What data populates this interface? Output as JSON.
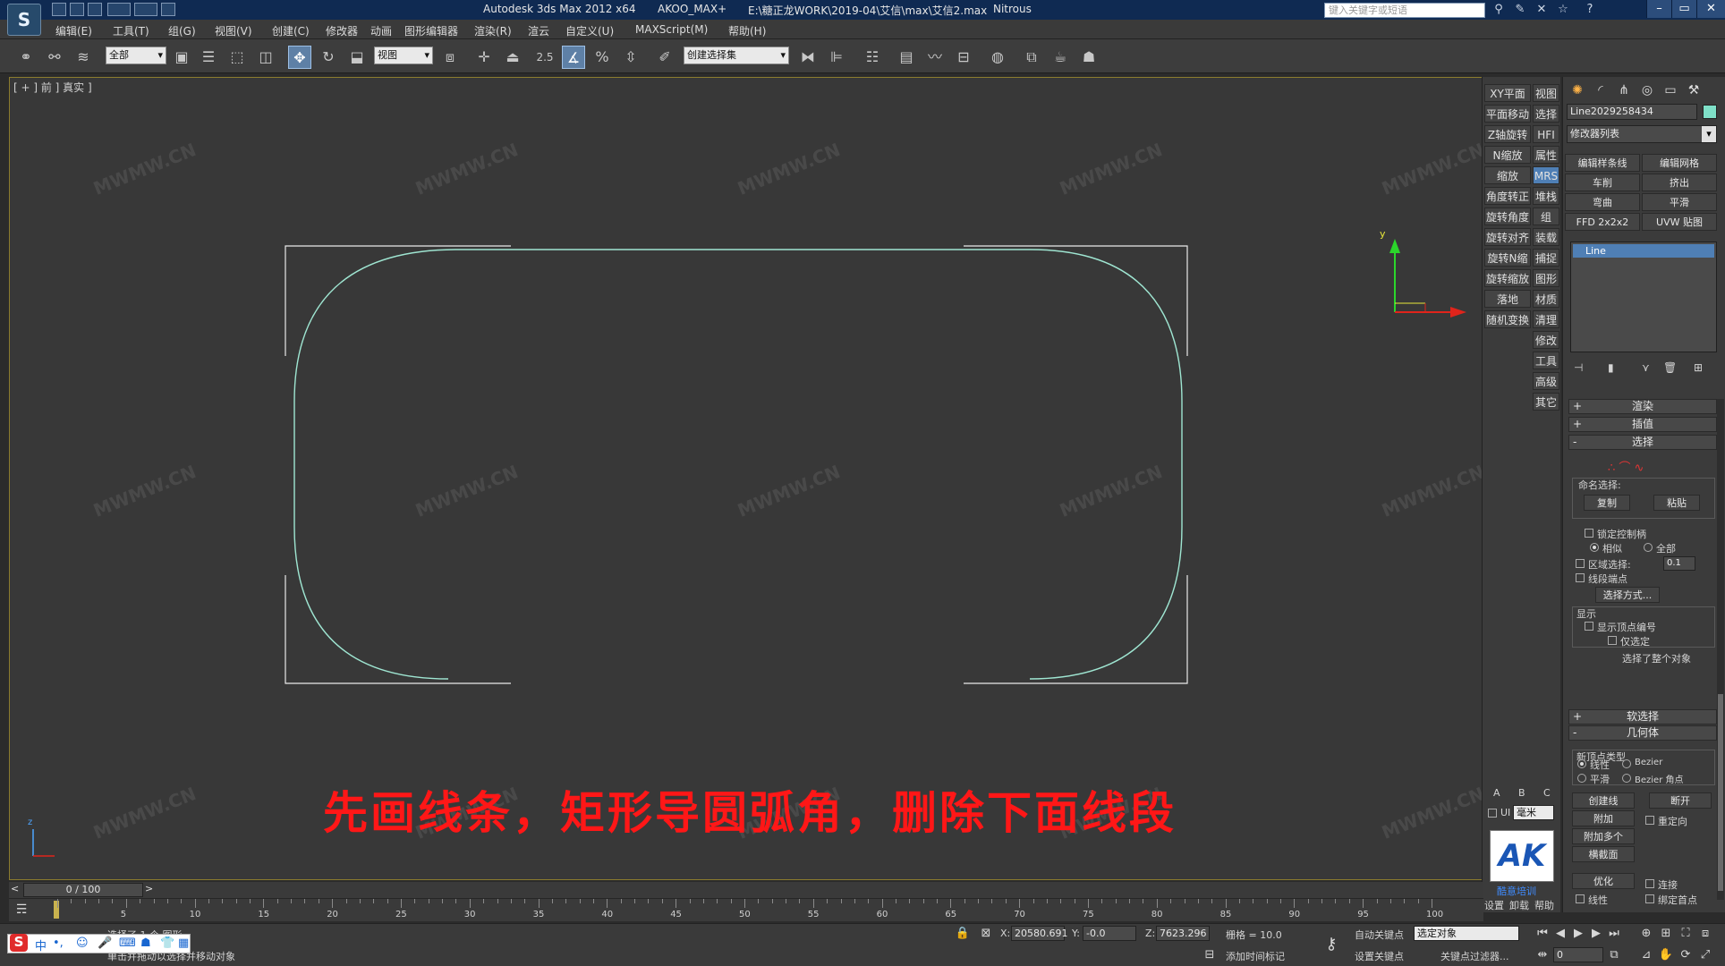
{
  "titlebar": {
    "app_title": "Autodesk 3ds Max  2012 x64",
    "plugin": "AKOO_MAX+",
    "file_path": "E:\\糖正龙WORK\\2019-04\\艾信\\max\\艾信2.max",
    "renderer": "Nitrous",
    "search_placeholder": "键入关键字或短语",
    "help_label": "?",
    "minimize": "–",
    "restore": "▭",
    "close": "✕"
  },
  "menu": [
    "编辑(E)",
    "工具(T)",
    "组(G)",
    "视图(V)",
    "创建(C)",
    "修改器",
    "动画",
    "图形编辑器",
    "渲染(R)",
    "渲云",
    "自定义(U)",
    "MAXScript(M)",
    "帮助(H)"
  ],
  "toolbar": {
    "selection_filter": "全部",
    "reference_coord": "视图",
    "snap_value": "2.5",
    "named_selection": "创建选择集"
  },
  "viewport": {
    "label": "[ + ] 前 ] 真实 ]",
    "axis_y": "y",
    "axis_z": "z",
    "watermark": "MWMW.CN",
    "caption": "先画线条，矩形导圆弧角，删除下面线段"
  },
  "command_strip": [
    [
      "XY平面",
      "视图"
    ],
    [
      "平面移动",
      "选择"
    ],
    [
      "Z轴旋转",
      "HFI"
    ],
    [
      "N缩放",
      "属性"
    ],
    [
      "缩放",
      "MRS"
    ],
    [
      "角度转正",
      "堆栈"
    ],
    [
      "旋转角度",
      "组"
    ],
    [
      "旋转对齐",
      "装载"
    ],
    [
      "旋转N缩",
      "捕捉"
    ],
    [
      "旋转缩放",
      "图形"
    ],
    [
      "落地",
      "材质"
    ],
    [
      "随机变换",
      "清理"
    ],
    [
      "",
      "修改"
    ],
    [
      "",
      "工具"
    ],
    [
      "",
      "高级"
    ],
    [
      "",
      "其它"
    ]
  ],
  "command_strip_bottom": {
    "abc": [
      "A",
      "B",
      "C"
    ],
    "units_label": "UI",
    "units_value": "毫米",
    "logo_text": "AK",
    "logo_caption": "酷意培训",
    "bottom_links": [
      "设置",
      "卸载",
      "帮助"
    ]
  },
  "panel": {
    "object_name": "Line2029258434",
    "object_color": "#7fe0c8",
    "modifier_list": "修改器列表",
    "mod_buttons": [
      "编辑样条线",
      "编辑网格",
      "车削",
      "挤出",
      "弯曲",
      "平滑",
      "FFD 2x2x2",
      "UVW 贴图"
    ],
    "stack_item": "Line",
    "rollouts": {
      "render": "渲染",
      "interp": "插值",
      "selection": "选择",
      "soft_sel": "软选择",
      "geometry": "几何体"
    },
    "named_sel": {
      "title": "命名选择:",
      "copy": "复制",
      "paste": "粘贴"
    },
    "lock_handles": "锁定控制柄",
    "alike": "相似",
    "all": "全部",
    "area_select": "区域选择:",
    "area_value": "0.1",
    "segment_end": "线段端点",
    "select_by": "选择方式...",
    "display": "显示",
    "show_vertex_num": "显示顶点编号",
    "selected_only": "仅选定",
    "selected_whole": "选择了整个对象",
    "new_vertex_type": "新顶点类型",
    "linear": "线性",
    "bezier": "Bezier",
    "smooth": "平滑",
    "bezier_corner": "Bezier 角点",
    "create_line": "创建线",
    "break": "断开",
    "attach": "附加",
    "reorient": "重定向",
    "attach_multi": "附加多个",
    "cross_section": "横截面",
    "optimize": "优化",
    "connect": "连接",
    "linear2": "线性",
    "bind_first": "绑定首点"
  },
  "timeline": {
    "frame": "0 / 100",
    "ticks": [
      "5",
      "10",
      "15",
      "20",
      "25",
      "30",
      "35",
      "40",
      "45",
      "50",
      "55",
      "60",
      "65",
      "70",
      "75",
      "80",
      "85",
      "90",
      "95",
      "100"
    ]
  },
  "status": {
    "selection_text": "选择了 1 个 图形",
    "prompt": "单击并拖动以选择并移动对象",
    "x_label": "X:",
    "x_value": "20580.691",
    "y_label": "Y:",
    "y_value": "-0.0",
    "z_label": "Z:",
    "z_value": "7623.296",
    "grid": "栅格 = 10.0",
    "add_time_tag": "添加时间标记",
    "auto_key": "自动关键点",
    "set_key": "设置关键点",
    "key_mode": "选定对象",
    "key_filter": "关键点过滤器...",
    "current_frame": "0",
    "ime": "中"
  }
}
